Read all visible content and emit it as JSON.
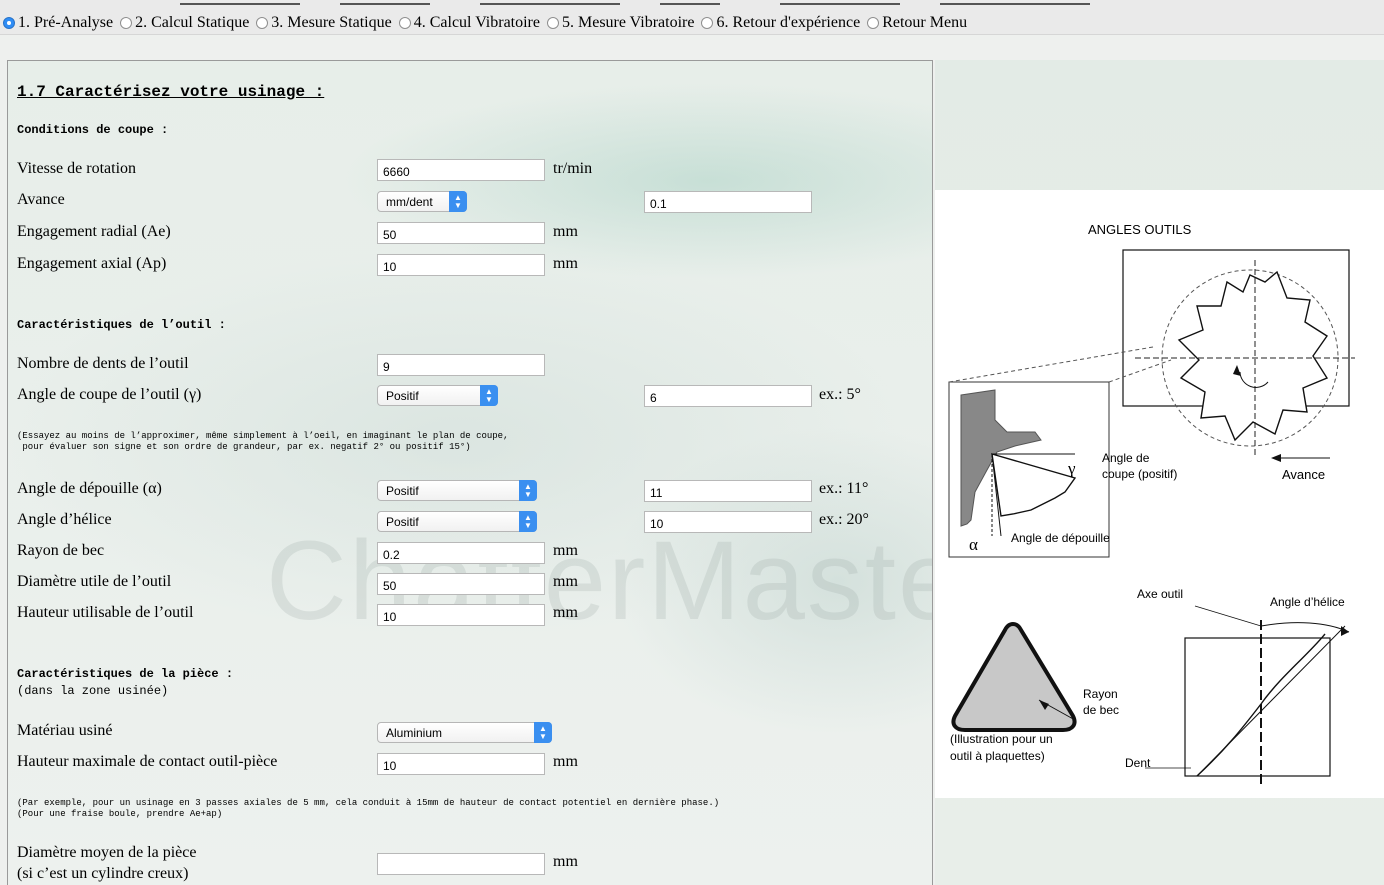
{
  "nav": {
    "items": [
      {
        "label": "1. Pré-Analyse",
        "selected": true
      },
      {
        "label": "2. Calcul Statique",
        "selected": false
      },
      {
        "label": "3. Mesure Statique",
        "selected": false
      },
      {
        "label": "4. Calcul Vibratoire",
        "selected": false
      },
      {
        "label": "5. Mesure Vibratoire",
        "selected": false
      },
      {
        "label": "6. Retour d'expérience",
        "selected": false
      },
      {
        "label": "Retour Menu",
        "selected": false
      }
    ]
  },
  "form": {
    "title": "1.7 Caractérisez votre usinage :",
    "watermark": "ChatterMaster",
    "sections": {
      "coupe": "Conditions de coupe :",
      "outil": "Caractéristiques de l’outil :",
      "piece_1": "Caractéristiques de la pièce :",
      "piece_2": "(dans la zone usinée)"
    },
    "fields": {
      "vitesse": {
        "label": "Vitesse de rotation",
        "value": "6660",
        "unit": "tr/min"
      },
      "avance": {
        "label": "Avance",
        "select": "mm/dent",
        "value": "0.1"
      },
      "ae": {
        "label": "Engagement radial (Ae)",
        "value": "50",
        "unit": "mm"
      },
      "ap": {
        "label": "Engagement axial (Ap)",
        "value": "10",
        "unit": "mm"
      },
      "dents": {
        "label": "Nombre de dents de l’outil",
        "value": "9"
      },
      "angle_coupe": {
        "label": "Angle de coupe de l’outil (γ)",
        "select": "Positif",
        "value": "6",
        "example": "ex.: 5°"
      },
      "angle_depouille": {
        "label": "Angle de dépouille (α)",
        "select": "Positif",
        "value": "11",
        "example": "ex.: 11°"
      },
      "angle_helice": {
        "label": "Angle d’hélice",
        "select": "Positif",
        "value": "10",
        "example": "ex.: 20°"
      },
      "rayon_bec": {
        "label": "Rayon de bec",
        "value": "0.2",
        "unit": "mm"
      },
      "diametre_outil": {
        "label": "Diamètre utile de l’outil",
        "value": "50",
        "unit": "mm"
      },
      "hauteur_outil": {
        "label": "Hauteur utilisable de l’outil",
        "value": "10",
        "unit": "mm"
      },
      "materiau": {
        "label": "Matériau usiné",
        "select": "Aluminium"
      },
      "hauteur_contact": {
        "label": "Hauteur maximale de contact outil-pièce",
        "value": "10",
        "unit": "mm"
      },
      "diametre_piece": {
        "label_1": "Diamètre moyen de la pièce",
        "label_2": "(si c’est un cylindre creux)",
        "value": "",
        "unit": "mm"
      }
    },
    "notes": {
      "angle_1": "(Essayez au moins de l’approximer, même simplement à l’oeil, en imaginant le plan de coupe,",
      "angle_2": " pour évaluer son signe et son ordre de grandeur, par ex. negatif 2° ou positif 15°)",
      "passes_1": "(Par exemple, pour un usinage en 3 passes axiales de 5 mm, cela conduit à 15mm de hauteur de contact potentiel en dernière phase.)",
      "passes_2": "(Pour une fraise boule, prendre Ae+ap)"
    }
  },
  "diagram": {
    "title": "ANGLES OUTILS",
    "gamma": "γ",
    "alpha": "α",
    "angle_coupe_1": "Angle de",
    "angle_coupe_2": "coupe (positif)",
    "avance": "Avance",
    "angle_depouille": "Angle de dépouille",
    "axe_outil": "Axe outil",
    "angle_helice": "Angle d’hélice",
    "rayon_1": "Rayon",
    "rayon_2": "de bec",
    "illus_1": "(Illustration pour un",
    "illus_2": "outil à plaquettes)",
    "dent": "Dent"
  },
  "colors": {
    "accent": "#3a8ff0",
    "panel_border": "#9a9a9a"
  }
}
